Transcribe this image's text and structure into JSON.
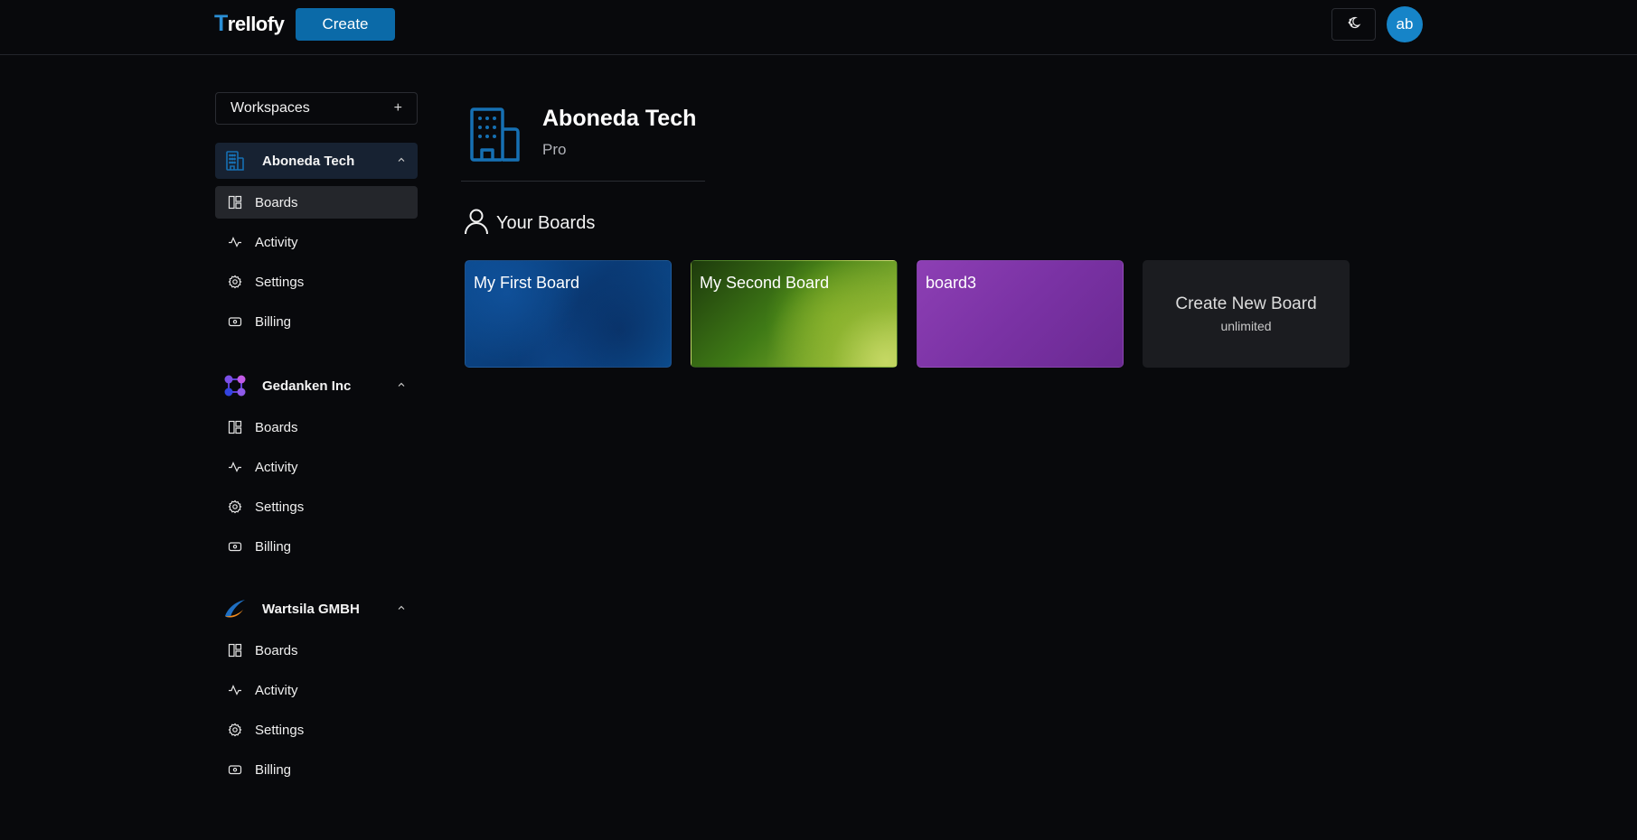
{
  "app": {
    "logo_initial": "T",
    "logo_rest": "rellofy",
    "create_label": "Create",
    "avatar_initials": "ab"
  },
  "colors": {
    "accent": "#0b6aa8",
    "avatar": "#1684c8",
    "active_workspace_bg": "#172232"
  },
  "sidebar": {
    "header_label": "Workspaces",
    "add_symbol": "+",
    "workspaces": [
      {
        "name": "Aboneda Tech",
        "icon": "building-icon",
        "expanded": true,
        "items": [
          {
            "label": "Boards",
            "icon": "boards-icon"
          },
          {
            "label": "Activity",
            "icon": "activity-icon"
          },
          {
            "label": "Settings",
            "icon": "gear-icon"
          },
          {
            "label": "Billing",
            "icon": "billing-icon"
          }
        ]
      },
      {
        "name": "Gedanken Inc",
        "icon": "molecule-logo-icon",
        "expanded": true,
        "items": [
          {
            "label": "Boards",
            "icon": "boards-icon"
          },
          {
            "label": "Activity",
            "icon": "activity-icon"
          },
          {
            "label": "Settings",
            "icon": "gear-icon"
          },
          {
            "label": "Billing",
            "icon": "billing-icon"
          }
        ]
      },
      {
        "name": "Wartsila GMBH",
        "icon": "swoosh-logo-icon",
        "expanded": true,
        "items": [
          {
            "label": "Boards",
            "icon": "boards-icon"
          },
          {
            "label": "Activity",
            "icon": "activity-icon"
          },
          {
            "label": "Settings",
            "icon": "gear-icon"
          },
          {
            "label": "Billing",
            "icon": "billing-icon"
          }
        ]
      }
    ]
  },
  "main": {
    "workspace_name": "Aboneda Tech",
    "workspace_plan": "Pro",
    "boards_heading": "Your Boards",
    "boards": [
      {
        "title": "My First Board"
      },
      {
        "title": "My Second Board"
      },
      {
        "title": "board3"
      }
    ],
    "create_board": {
      "title": "Create New Board",
      "subtitle": "unlimited"
    }
  }
}
